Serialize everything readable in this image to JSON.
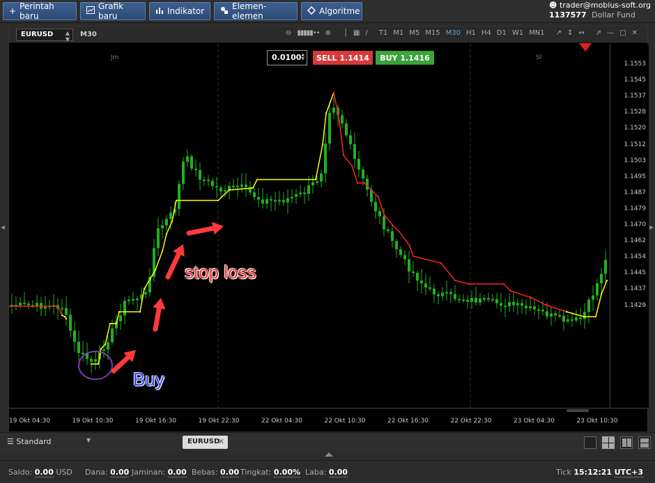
{
  "toolbar": {
    "buttons": [
      {
        "label": "Perintah baru",
        "icon": "plus-icon"
      },
      {
        "label": "Grafik baru",
        "icon": "chart-icon"
      },
      {
        "label": "Indikator",
        "icon": "bar-chart-icon"
      },
      {
        "label": "Elemen-elemen",
        "icon": "shapes-icon"
      },
      {
        "label": "Algoritme",
        "icon": "diamond-icon"
      }
    ],
    "account_email": "trader@mobius-soft.org",
    "account_id": "1137577",
    "account_fund": "Dollar Fund"
  },
  "chart": {
    "symbol": "EURUSD",
    "timeframe": "M30",
    "timeframes": [
      "T1",
      "M1",
      "M5",
      "M15",
      "M30",
      "H1",
      "H4",
      "D1",
      "W1",
      "MN1"
    ],
    "active_timeframe": "M30",
    "session_marks": [
      "Jm",
      "Sl"
    ],
    "lot": "0.0100",
    "sell_label": "SELL",
    "sell_price": "1.1414",
    "buy_label": "BUY",
    "buy_price": "1.1416",
    "price_labels": [
      "1.1553",
      "1.1545",
      "1.1537",
      "1.1528",
      "1.1520",
      "1.1512",
      "1.1503",
      "1.1495",
      "1.1487",
      "1.1479",
      "1.1470",
      "1.1462",
      "1.1454",
      "1.1445",
      "1.1437",
      "1.1429"
    ],
    "time_labels": [
      "19 Okt 04:30",
      "19 Okt 10:30",
      "19 Okt 16:30",
      "19 Okt 22:30",
      "22 Okt 04:30",
      "22 Okt 10:30",
      "22 Okt 16:30",
      "22 Okt 22:30",
      "23 Okt 04:30",
      "23 Okt 10:30"
    ],
    "annotation_stop": "stop loss",
    "annotation_buy": "Buy",
    "colors": {
      "bull": "#22b022",
      "stop_up": "#ffff00",
      "stop_down": "#ff2020",
      "background": "#000000"
    }
  },
  "tabs": {
    "profile": "Standard",
    "chart_tab": "EURUSD"
  },
  "status": {
    "saldo_label": "Saldo:",
    "saldo_value": "0.00",
    "saldo_currency": "USD",
    "dana_label": "Dana:",
    "dana_value": "0.00",
    "jaminan_label": "Jaminan:",
    "jaminan_value": "0.00",
    "bebas_label": "Bebas:",
    "bebas_value": "0.00",
    "tingkat_label": "Tingkat:",
    "tingkat_value": "0.00%",
    "laba_label": "Laba:",
    "laba_value": "0.00",
    "tick_label": "Tick",
    "time": "15:12:21",
    "tz": "UTC+3"
  }
}
